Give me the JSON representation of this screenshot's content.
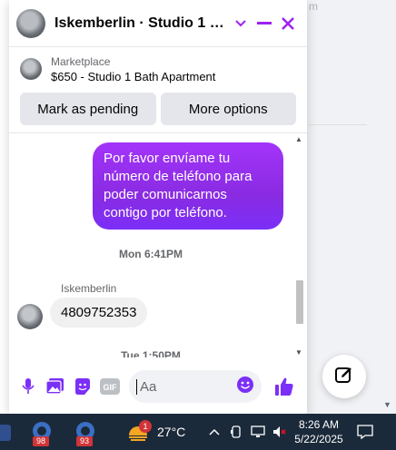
{
  "background": {
    "faded_text": "m"
  },
  "chat": {
    "title": "Iskemberlin · Studio 1 Bath...",
    "listing": {
      "label": "Marketplace",
      "title": "$650 - Studio 1 Bath Apartment"
    },
    "actions": {
      "mark_pending": "Mark as pending",
      "more_options": "More options"
    },
    "messages": {
      "outgoing_text": "Por favor envíame tu número de teléfono para poder comunicarnos contigo por teléfono.",
      "timestamp_1": "Mon 6:41PM",
      "sender_name": "Iskemberlin",
      "incoming_text": "4809752353",
      "timestamp_2": "Tue 1:50PM"
    },
    "composer": {
      "placeholder": "Aa"
    },
    "accent_color": "#a020f0"
  },
  "taskbar": {
    "app_badge_1": "98",
    "app_badge_2": "93",
    "weather_badge": "1",
    "temperature": "27°C",
    "time": "8:26 AM",
    "date": "5/22/2025"
  }
}
